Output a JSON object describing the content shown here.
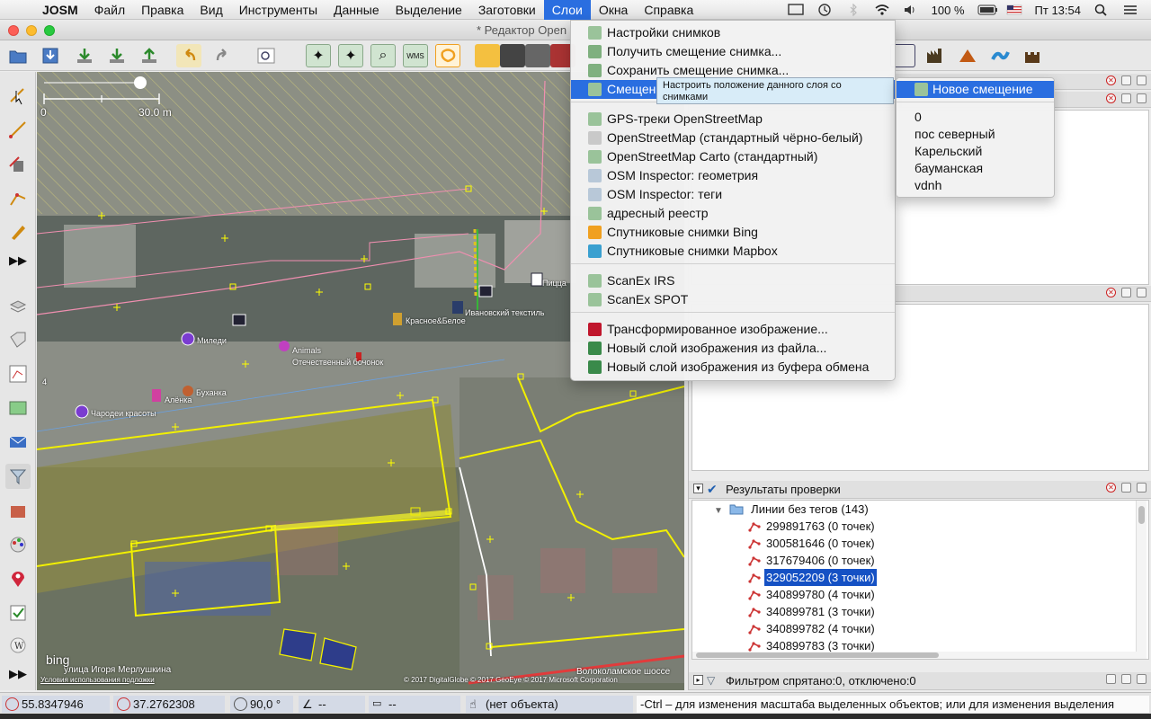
{
  "menubar": {
    "app_name": "JOSM",
    "items": [
      "Файл",
      "Правка",
      "Вид",
      "Инструменты",
      "Данные",
      "Выделение",
      "Заготовки",
      "Слои",
      "Окна",
      "Справка"
    ],
    "active_item": "Слои",
    "battery": "100 %",
    "clock": "Пт 13:54"
  },
  "window": {
    "title": "* Редактор Open"
  },
  "map": {
    "scale_zero": "0",
    "scale_label": "30.0 m",
    "bing_logo": "bing",
    "terms_text": "Условия использования подложки",
    "copyright": "© 2017 DigitalGlobe © 2017 GeoEye © 2017 Microsoft Corporation",
    "street_label_1": "улица Игоря Мерлушкина",
    "street_label_2": "Волоколамское шоссе",
    "labels": {
      "miledi": "Миледи",
      "animals": "Animals",
      "bochonok": "Отечественный бочонок",
      "krasnoe": "Красное&Белое",
      "ivanovo": "Ивановский текстиль",
      "chorodei": "Чародеи красоты",
      "alenka": "Алёнка",
      "bujanka": "Буханка",
      "pizza": "Пицца"
    },
    "left_number": "4"
  },
  "layers_menu": {
    "items": [
      {
        "label": "Настройки снимков",
        "icon_color": "#9ac39a"
      },
      {
        "label": "Получить смещение снимка...",
        "icon_color": "#7fb07f"
      },
      {
        "label": "Сохранить смещение снимка...",
        "icon_color": "#7fb07f"
      },
      {
        "label": "Смещение",
        "icon_color": "#9ac39a",
        "highlighted": true,
        "submenu": true
      },
      {
        "label": "GPS-треки OpenStreetMap",
        "icon_color": "#9ac39a"
      },
      {
        "label": "OpenStreetMap (стандартный чёрно-белый)",
        "icon_color": "#c9c9c9"
      },
      {
        "label": "OpenStreetMap Carto (стандартный)",
        "icon_color": "#9ac39a"
      },
      {
        "label": "OSM Inspector: геометрия",
        "icon_color": "#b8c8d8"
      },
      {
        "label": "OSM Inspector: теги",
        "icon_color": "#b8c8d8"
      },
      {
        "label": "адресный реестр",
        "icon_color": "#9ac39a"
      },
      {
        "label": "Спутниковые снимки Bing",
        "icon_color": "#f0a020"
      },
      {
        "label": "Спутниковые снимки Mapbox",
        "icon_color": "#3aa0d0"
      },
      {
        "label": "ScanEx IRS",
        "icon_color": "#9ac39a"
      },
      {
        "label": "ScanEx SPOT",
        "icon_color": "#9ac39a"
      },
      {
        "label": "Трансформированное изображение...",
        "icon_color": "#c0162c"
      },
      {
        "label": "Новый слой изображения из файла...",
        "icon_color": "#3a8a4a"
      },
      {
        "label": "Новый слой изображения из буфера обмена",
        "icon_color": "#3a8a4a"
      }
    ]
  },
  "tooltip": {
    "text": "Настроить положение данного слоя со снимками"
  },
  "offset_submenu": {
    "new_offset": "Новое смещение",
    "items": [
      "0",
      "пос северный",
      "Карельский",
      "бауманская",
      "vdnh"
    ]
  },
  "validation": {
    "title": "Результаты проверки",
    "group": "Линии без тегов (143)",
    "rows": [
      {
        "label": "299891763 (0 точек)",
        "selected": false
      },
      {
        "label": "300581646 (0 точек)",
        "selected": false
      },
      {
        "label": "317679406 (0 точек)",
        "selected": false
      },
      {
        "label": "329052209 (3 точки)",
        "selected": true
      },
      {
        "label": "340899780 (4 точки)",
        "selected": false
      },
      {
        "label": "340899781 (3 точки)",
        "selected": false
      },
      {
        "label": "340899782 (4 точки)",
        "selected": false
      },
      {
        "label": "340899783 (3 точки)",
        "selected": false
      }
    ]
  },
  "filter_panel": {
    "title": "Фильтром спрятано:0, отключено:0"
  },
  "statusbar": {
    "lat": "55.8347946",
    "lon": "37.2762308",
    "heading": "90,0 °",
    "angle": "--",
    "length": "--",
    "object": "(нет объекта)",
    "hint": "-Ctrl – для изменения масштаба выделенных объектов; или для изменения выделения"
  }
}
